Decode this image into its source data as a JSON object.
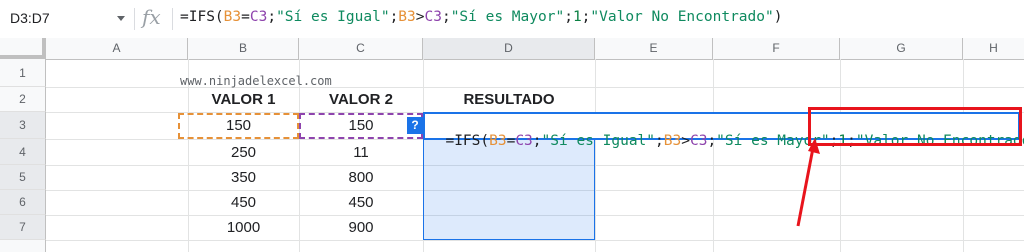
{
  "formula_bar": {
    "name_box": "D3:D7",
    "fx": "fx",
    "formula_parts": [
      {
        "t": "=IFS(",
        "c": "plain"
      },
      {
        "t": "B3",
        "c": "orange"
      },
      {
        "t": "=",
        "c": "plain"
      },
      {
        "t": "C3",
        "c": "purple"
      },
      {
        "t": ";",
        "c": "plain"
      },
      {
        "t": "\"Sí es Igual\"",
        "c": "str"
      },
      {
        "t": ";",
        "c": "plain"
      },
      {
        "t": "B3",
        "c": "orange"
      },
      {
        "t": ">",
        "c": "plain"
      },
      {
        "t": "C3",
        "c": "purple"
      },
      {
        "t": ";",
        "c": "plain"
      },
      {
        "t": "\"Sí es Mayor\"",
        "c": "str"
      },
      {
        "t": ";",
        "c": "plain"
      },
      {
        "t": "1",
        "c": "num"
      },
      {
        "t": ";",
        "c": "plain"
      },
      {
        "t": "\"Valor No Encontrado\"",
        "c": "str"
      },
      {
        "t": ")",
        "c": "plain"
      }
    ]
  },
  "columns": [
    "A",
    "B",
    "C",
    "D",
    "E",
    "F",
    "G",
    "H"
  ],
  "rows": [
    "1",
    "2",
    "3",
    "4",
    "5",
    "6",
    "7"
  ],
  "watermark": "www.ninjadelexcel.com",
  "headers": {
    "b": "VALOR 1",
    "c": "VALOR 2",
    "d": "RESULTADO"
  },
  "table": [
    {
      "b": "150",
      "c": "150"
    },
    {
      "b": "250",
      "c": "11"
    },
    {
      "b": "350",
      "c": "800"
    },
    {
      "b": "450",
      "c": "450"
    },
    {
      "b": "1000",
      "c": "900"
    }
  ],
  "editor_button": "?",
  "colors": {
    "accent": "#1a73e8",
    "annotation": "#e8141c",
    "ref1": "#e69138",
    "ref2": "#8e44ad"
  }
}
